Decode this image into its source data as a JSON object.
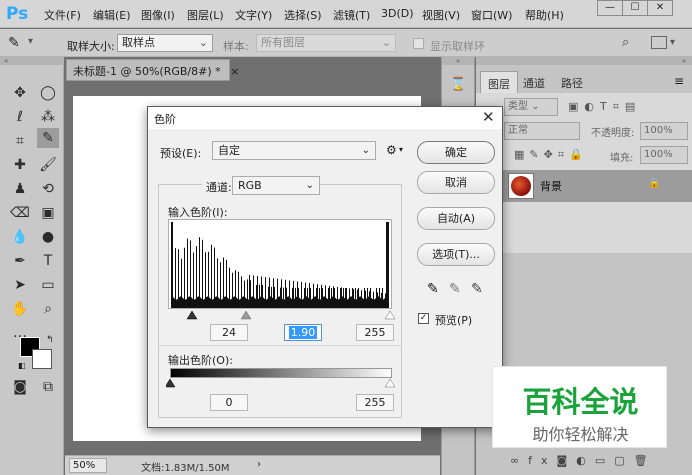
{
  "app": {
    "logo": "Ps"
  },
  "menu": [
    "文件(F)",
    "编辑(E)",
    "图像(I)",
    "图层(L)",
    "文字(Y)",
    "选择(S)",
    "滤镜(T)",
    "3D(D)",
    "视图(V)",
    "窗口(W)",
    "帮助(H)"
  ],
  "window_controls": [
    "—",
    "☐",
    "✕"
  ],
  "options": {
    "sample_size_label": "取样大小:",
    "sample_size_value": "取样点",
    "sample_label": "样本:",
    "sample_value": "所有图层",
    "show_ring_label": "显示取样环"
  },
  "document": {
    "tab_title": "未标题-1 @ 50%(RGB/8#) *",
    "zoom": "50%",
    "doc_info": "文档:1.83M/1.50M"
  },
  "panel": {
    "tabs": [
      "图层",
      "通道",
      "路径"
    ],
    "kind_label": "类型",
    "mode_label": "正常",
    "opacity_label": "不透明度:",
    "opacity_value": "100%",
    "lock_label": "锁定:",
    "fill_label": "填充:",
    "fill_value": "100%",
    "layer_name": "背景",
    "footer_icons": [
      "link-icon",
      "fx-icon",
      "mask-icon",
      "adjustment-icon",
      "group-icon",
      "new-layer-icon",
      "trash-icon"
    ]
  },
  "levels_dialog": {
    "title": "色阶",
    "preset_label": "预设(E):",
    "preset_value": "自定",
    "channel_label": "通道:",
    "channel_value": "RGB",
    "input_levels_label": "输入色阶(I):",
    "input_black": "24",
    "input_gamma": "1.90",
    "input_white": "255",
    "output_levels_label": "输出色阶(O):",
    "output_black": "0",
    "output_white": "255",
    "ok_label": "确定",
    "cancel_label": "取消",
    "auto_label": "自动(A)",
    "options_label": "选项(T)...",
    "preview_label": "预览(P)",
    "preview_checked": true
  },
  "watermark": {
    "title": "百科全说",
    "subtitle": "助你轻松解决"
  },
  "colors": {
    "accent": "#31a8ff",
    "watermark_green": "#1aa33b"
  }
}
